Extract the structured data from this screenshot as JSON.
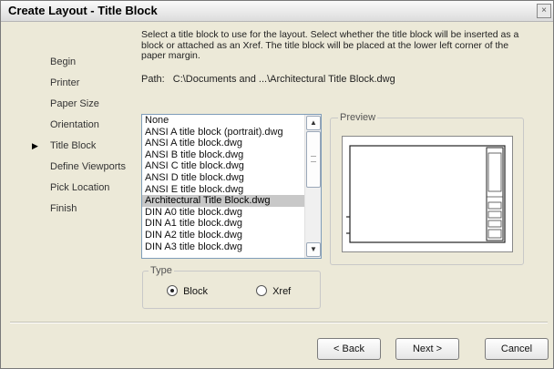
{
  "dialog": {
    "title": "Create Layout - Title Block",
    "close_glyph": "×"
  },
  "steps": [
    {
      "label": "Begin"
    },
    {
      "label": "Printer"
    },
    {
      "label": "Paper Size"
    },
    {
      "label": "Orientation"
    },
    {
      "label": "Title Block",
      "current": true
    },
    {
      "label": "Define Viewports"
    },
    {
      "label": "Pick Location"
    },
    {
      "label": "Finish"
    }
  ],
  "instructions": "Select a title block to use for the layout. Select whether the title block will be inserted as a block or attached as an Xref. The title block will be placed at the lower left corner of the paper margin.",
  "path": {
    "label": "Path:",
    "value": "C:\\Documents and ...\\Architectural Title Block.dwg"
  },
  "title_block_list": {
    "items": [
      "None",
      "ANSI A title block (portrait).dwg",
      "ANSI A title block.dwg",
      "ANSI B title block.dwg",
      "ANSI C title block.dwg",
      "ANSI D title block.dwg",
      "ANSI E title block.dwg",
      "Architectural Title Block.dwg",
      "DIN A0 title block.dwg",
      "DIN A1 title block.dwg",
      "DIN A2 title block.dwg",
      "DIN A3 title block.dwg"
    ],
    "selected_index": 7
  },
  "preview": {
    "label": "Preview"
  },
  "type": {
    "label": "Type",
    "options": [
      {
        "label": "Block",
        "checked": true
      },
      {
        "label": "Xref",
        "checked": false
      }
    ]
  },
  "buttons": {
    "back": "< Back",
    "next": "Next >",
    "cancel": "Cancel"
  },
  "icons": {
    "current_step": "▶",
    "scroll_up": "▲",
    "scroll_down": "▼"
  }
}
